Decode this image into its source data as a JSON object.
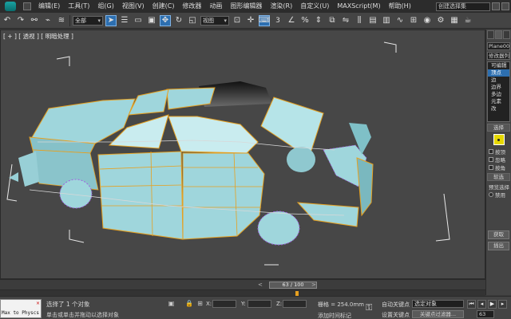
{
  "menu": {
    "items": [
      "编辑(E)",
      "工具(T)",
      "组(G)",
      "视图(V)",
      "创建(C)",
      "修改器",
      "动画",
      "图形编辑器",
      "渲染(R)",
      "自定义(U)",
      "MAXScript(M)",
      "帮助(H)"
    ],
    "selection_set_placeholder": "创建选择集"
  },
  "toolbar": {
    "filter_value": "全部",
    "refcoord_value": "视图",
    "snap_number": "3"
  },
  "viewport": {
    "label": "[ + ] [ 透视 ] [ 明暗处理 ]"
  },
  "command_panel": {
    "object_name": "Plane003",
    "modifier_list": "修改器列表",
    "stack": [
      "可编辑",
      "顶点",
      "边",
      "边界",
      "多边",
      "元素",
      "改"
    ],
    "selected_stack_index": 1,
    "selection_rollout": "选择",
    "checks": [
      "按顶",
      "忽略",
      "按角"
    ],
    "soft_label": "软选",
    "preview_label": "预览选择",
    "preview_option": "禁用",
    "buttons": [
      "获取",
      "插出"
    ]
  },
  "timeslider": {
    "frame_label": "63 / 100",
    "current_frame": 63,
    "total_frames": 100,
    "prev": "<",
    "next": ">"
  },
  "status": {
    "maxscript_text": "Max to Physcs",
    "selection": "选择了 1 个对象",
    "prompt": "单击或单击并拖动以选择对象",
    "x_label": "X:",
    "y_label": "Y:",
    "z_label": "Z:",
    "grid": "栅格 = 254.0mm",
    "add_time_tag": "添加时间标记",
    "auto_key": "自动关键点",
    "auto_key_value": "选定对象",
    "set_key": "设置关键点",
    "key_filters": "关键点过滤器...",
    "frame_value": "63"
  },
  "colors": {
    "viewport_bg": "#474747",
    "panel_face": "#9fd6dc",
    "selection_edge": "#e6a020",
    "soft_dash": "#a060e0",
    "active_blue": "#2d6fb0"
  }
}
